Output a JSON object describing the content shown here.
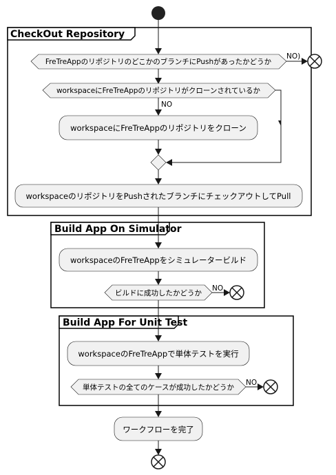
{
  "partitions": {
    "checkout": "CheckOut Repository",
    "build_sim": "Build App On Simulator",
    "unit_test": "Build App For Unit Test"
  },
  "decisions": {
    "push_exists": "FreTreAppのリポジトリのどこかのブランチにPushがあったかどうか",
    "cloned": "workspaceにFreTreAppのリポジトリがクローンされているか",
    "build_ok": "ビルドに成功したかどうか",
    "tests_ok": "単体テストの全てのケースが成功したかどうか"
  },
  "activities": {
    "clone": "workspaceにFreTreAppのリポジトリをクローン",
    "checkout_pull": "workspaceのリポジトリをPushされたブランチにチェックアウトしてPull",
    "sim_build": "workspaceのFreTreAppをシミュレータービルド",
    "run_tests": "workspaceのFreTreAppで単体テストを実行",
    "finish": "ワークフローを完了"
  },
  "edge_labels": {
    "push_no": "NO)",
    "cloned_no": "NO",
    "build_no": "NO",
    "tests_no": "NO"
  }
}
